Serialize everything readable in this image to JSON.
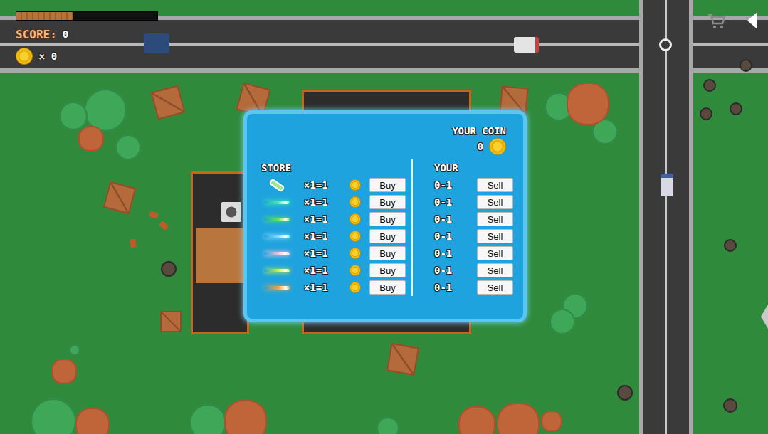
{
  "hud": {
    "health": {
      "level": 0.4
    },
    "score_label": "SCORE:",
    "score": "0",
    "coin_separator": "×",
    "coins": "0"
  },
  "store": {
    "coin_label": "YOUR COIN",
    "coin": "0",
    "store_label": "STORE",
    "your_label": "YOUR",
    "items": [
      {
        "kind": "potion",
        "price": "×1=1",
        "buy": "Buy",
        "owned": "0-1",
        "sell": "Sell",
        "color": "#9be88f"
      },
      {
        "kind": "bullet",
        "price": "×1=1",
        "buy": "Buy",
        "owned": "0-1",
        "sell": "Sell",
        "color": "#3ef0a0"
      },
      {
        "kind": "bullet",
        "price": "×1=1",
        "buy": "Buy",
        "owned": "0-1",
        "sell": "Sell",
        "color": "#5be84a"
      },
      {
        "kind": "bullet",
        "price": "×1=1",
        "buy": "Buy",
        "owned": "0-1",
        "sell": "Sell",
        "color": "#8fd8ff"
      },
      {
        "kind": "bullet",
        "price": "×1=1",
        "buy": "Buy",
        "owned": "0-1",
        "sell": "Sell",
        "color": "#f0c0e0"
      },
      {
        "kind": "bullet",
        "price": "×1=1",
        "buy": "Buy",
        "owned": "0-1",
        "sell": "Sell",
        "color": "#c8f040"
      },
      {
        "kind": "bullet",
        "price": "×1=1",
        "buy": "Buy",
        "owned": "0-1",
        "sell": "Sell",
        "color": "#ffa030"
      }
    ]
  }
}
